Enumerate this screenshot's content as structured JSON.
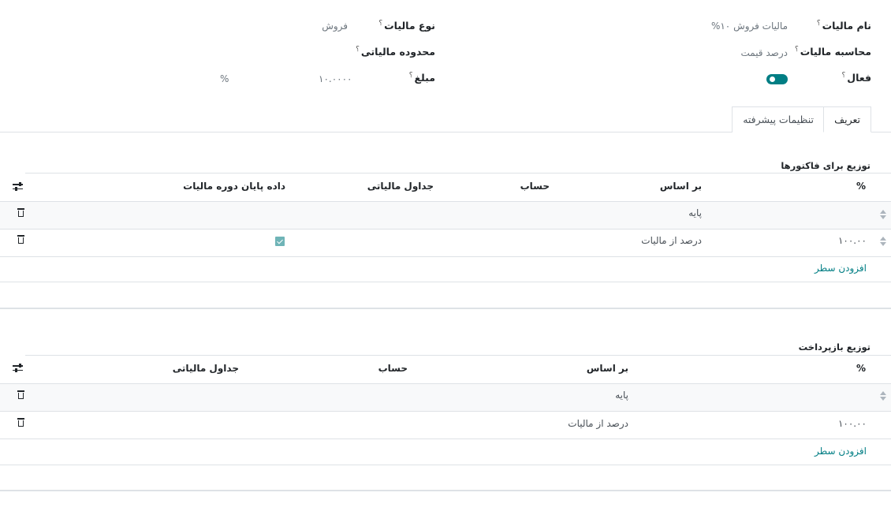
{
  "form": {
    "tax_name_label": "نام مالیات",
    "tax_name_value": "مالیات فروش ۱۰%",
    "tax_type_label": "نوع مالیات",
    "tax_type_value": "فروش",
    "tax_computation_label": "محاسبه مالیات",
    "tax_computation_value": "درصد قیمت",
    "tax_scope_label": "محدوده مالیاتی",
    "active_label": "فعال",
    "active_value": true,
    "amount_label": "مبلغ",
    "amount_value": "۱۰.۰۰۰۰",
    "amount_unit": "%",
    "help_mark": "؟"
  },
  "tabs": [
    {
      "label": "تعریف",
      "active": true
    },
    {
      "label": "تنظیمات پیشرفته",
      "active": false
    }
  ],
  "invoice_distribution": {
    "title": "توزیع برای فاکتورها",
    "columns": [
      "%",
      "بر اساس",
      "حساب",
      "جداول مالیاتی",
      "داده پایان دوره مالیات"
    ],
    "rows": [
      {
        "percent": "",
        "based_on": "پایه",
        "account": "",
        "tax_grids": "",
        "closing_entry": false
      },
      {
        "percent": "۱۰۰.۰۰",
        "based_on": "درصد از مالیات",
        "account": "",
        "tax_grids": "",
        "closing_entry": true
      }
    ],
    "add_line": "افزودن سطر"
  },
  "refund_distribution": {
    "title": "توزیع بازپرداخت",
    "columns": [
      "%",
      "بر اساس",
      "حساب",
      "جداول مالیاتی"
    ],
    "rows": [
      {
        "percent": "",
        "based_on": "پایه",
        "account": "",
        "tax_grids": ""
      },
      {
        "percent": "۱۰۰.۰۰",
        "based_on": "درصد از مالیات",
        "account": "",
        "tax_grids": ""
      }
    ],
    "add_line": "افزودن سطر"
  },
  "colors": {
    "accent": "#017e84",
    "checkbox": "#6fb4b7",
    "border": "#dee2e6"
  }
}
